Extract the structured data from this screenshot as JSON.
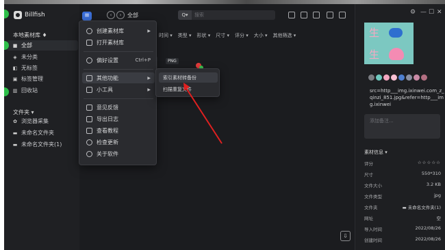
{
  "app": {
    "name": "Billfish"
  },
  "sidebar": {
    "library_label": "本地素材库 ♦",
    "items": [
      {
        "label": "全部",
        "icon": "grid-icon"
      },
      {
        "label": "未分类",
        "icon": "uncategorized-icon"
      },
      {
        "label": "无标签",
        "icon": "no-tag-icon"
      },
      {
        "label": "标签管理",
        "icon": "tag-manage-icon"
      },
      {
        "label": "回收站",
        "icon": "trash-icon"
      }
    ],
    "folders_label": "文件夹 ▾",
    "folders": [
      {
        "label": "浏览器采集",
        "icon": "browser-icon"
      },
      {
        "label": "未命名文件夹",
        "icon": "folder-icon"
      },
      {
        "label": "未命名文件夹(1)",
        "icon": "folder-icon"
      }
    ]
  },
  "toolbar": {
    "breadcrumb": "全部",
    "search_prefix": "Q▾",
    "search_placeholder": "搜索"
  },
  "filters": [
    "时间 ▾",
    "类型 ▾",
    "形状 ▾",
    "尺寸 ▾",
    "评分 ▾",
    "大小 ▾",
    "其他筛选 ▾"
  ],
  "grid": {
    "format_tag": "PNG"
  },
  "main_menu": {
    "items": [
      {
        "label": "创建素材库",
        "arrow": "▶"
      },
      {
        "label": "打开素材库"
      },
      {
        "label": "偏好设置",
        "shortcut": "Ctrl+P"
      },
      {
        "label": "其他功能",
        "arrow": "▶"
      },
      {
        "label": "小工具",
        "arrow": "▶"
      },
      {
        "label": "意见反馈"
      },
      {
        "label": "导出日志"
      },
      {
        "label": "查看教程"
      },
      {
        "label": "检查更新"
      },
      {
        "label": "关于软件"
      }
    ]
  },
  "sub_menu": {
    "items": [
      {
        "label": "索引素材转备份"
      },
      {
        "label": "扫描重复文件"
      }
    ]
  },
  "inspector": {
    "window_controls": [
      "⚙",
      "—",
      "☐",
      "✕"
    ],
    "preview_chars": [
      "生",
      "生"
    ],
    "swatches": [
      "#7a7d82",
      "#6fc9bf",
      "#f3a6c0",
      "#f7c0d3",
      "#4e7fd0",
      "#8a8fa0",
      "#c98aa6",
      "#b36f82"
    ],
    "source": "src=http___img.ixinwei.com_z_qinzi_851.jpg&refer=http___img.ixinwei",
    "note_placeholder": "添加备注...",
    "info_title": "素材信息 ▾",
    "info": [
      {
        "key": "评分",
        "value": "☆☆☆☆☆"
      },
      {
        "key": "尺寸",
        "value": "550*310"
      },
      {
        "key": "文件大小",
        "value": "3.2 KB"
      },
      {
        "key": "文件类型",
        "value": "jpg"
      },
      {
        "key": "文件夹",
        "value": "▬ 未命名文件夹(1)"
      },
      {
        "key": "网址",
        "value": "空"
      },
      {
        "key": "导入时间",
        "value": "2022/08/26"
      },
      {
        "key": "创建时间",
        "value": "2022/08/26"
      }
    ]
  },
  "colors": {
    "accent": "#3b6fd8",
    "annotation_arrow": "#e02020",
    "background": "#1b1c1f"
  }
}
